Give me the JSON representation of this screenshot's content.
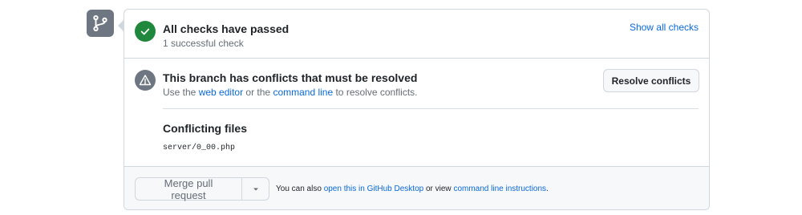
{
  "checks": {
    "title": "All checks have passed",
    "subtitle": "1 successful check",
    "show_all_label": "Show all checks"
  },
  "conflicts": {
    "title": "This branch has conflicts that must be resolved",
    "subtitle_prefix": "Use the ",
    "web_editor_link": "web editor",
    "subtitle_middle": " or the ",
    "command_line_link": "command line",
    "subtitle_suffix": " to resolve conflicts.",
    "resolve_button_label": "Resolve conflicts",
    "conflicting_files_title": "Conflicting files",
    "files": [
      "server/0_00.php"
    ]
  },
  "merge": {
    "button_label": "Merge pull request",
    "note_prefix": "You can also ",
    "desktop_link": "open this in GitHub Desktop",
    "note_middle": " or view ",
    "instructions_link": "command line instructions",
    "note_suffix": "."
  },
  "colors": {
    "success": "#1f883d",
    "neutral": "#6e7781",
    "link": "#0969da"
  },
  "icons": {
    "avatar": "git-branch-icon",
    "checks_status": "check-icon",
    "conflicts_status": "alert-icon",
    "merge_dropdown": "triangle-down-icon"
  }
}
